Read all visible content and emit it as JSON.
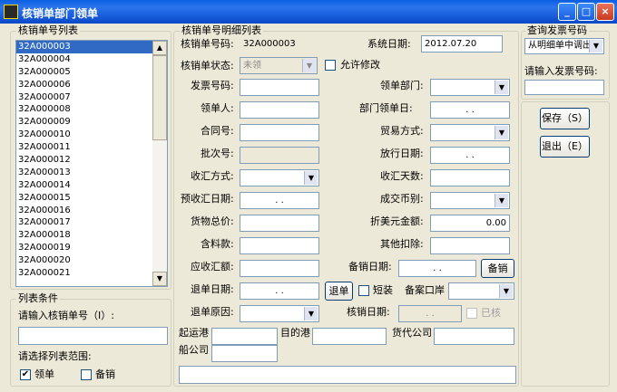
{
  "window": {
    "title": "核销单部门领单",
    "min": "_",
    "max": "□",
    "close": "×"
  },
  "list_panel": {
    "label": "核销单号列表",
    "items": [
      "32A000003",
      "32A000004",
      "32A000005",
      "32A000006",
      "32A000007",
      "32A000008",
      "32A000009",
      "32A000010",
      "32A000011",
      "32A000012",
      "32A000013",
      "32A000014",
      "32A000015",
      "32A000016",
      "32A000017",
      "32A000018",
      "32A000019",
      "32A000020",
      "32A000021"
    ],
    "selected_index": 0
  },
  "list_conditions": {
    "label": "列表条件",
    "input_prompt": "请输入核销单号（I）:",
    "input_value": "",
    "range_prompt": "请选择列表范围:",
    "check_lingdan": "领单",
    "check_beixiao": "备销",
    "lingdan_checked": true,
    "beixiao_checked": false
  },
  "detail": {
    "label": "核销单号明细列表",
    "number_label": "核销单号码:",
    "number_value": "32A000003",
    "sysdate_label": "系统日期:",
    "sysdate_value": "2012.07.20",
    "status_label": "核销单状态:",
    "status_value": "未领",
    "allow_edit": "允许修改",
    "invoice_no": "发票号码:",
    "dept": "领单部门:",
    "receiver": "领单人:",
    "dept_receive_date": "部门领单日:",
    "contract_no": "合同号:",
    "trade_mode": "贸易方式:",
    "batch_no": "批次号:",
    "release_date": "放行日期:",
    "fx_mode": "收汇方式:",
    "fx_days": "收汇天数:",
    "pre_fx_date": "预收汇日期:",
    "currency": "成交币别:",
    "total_price": "货物总价:",
    "usd_amount": "折美元金额:",
    "usd_amount_value": "0.00",
    "commission": "含料款:",
    "other_deduct": "其他扣除:",
    "receivable": "应收汇额:",
    "bx_date": "备销日期:",
    "bx_button": "备销",
    "refund_date": "退单日期:",
    "refund_button": "退单",
    "short_ship": "短装",
    "port_label": "备案口岸",
    "refund_reason": "退单原因:",
    "hx_date": "核销日期:",
    "hx_done": "已核",
    "date_placeholder": ".   .",
    "origin_port": "起运港",
    "dest_port": "目的港",
    "forwarder": "货代公司",
    "shipping_co": "船公司"
  },
  "query": {
    "label": "查询发票号码",
    "source_value": "从明细单中调出",
    "prompt": "请输入发票号码:",
    "save": "保存（S）",
    "exit": "退出（E）"
  },
  "colors": {
    "title_bar": "#0A5FE0",
    "selection": "#316AC5",
    "face": "#ECE9D8"
  }
}
